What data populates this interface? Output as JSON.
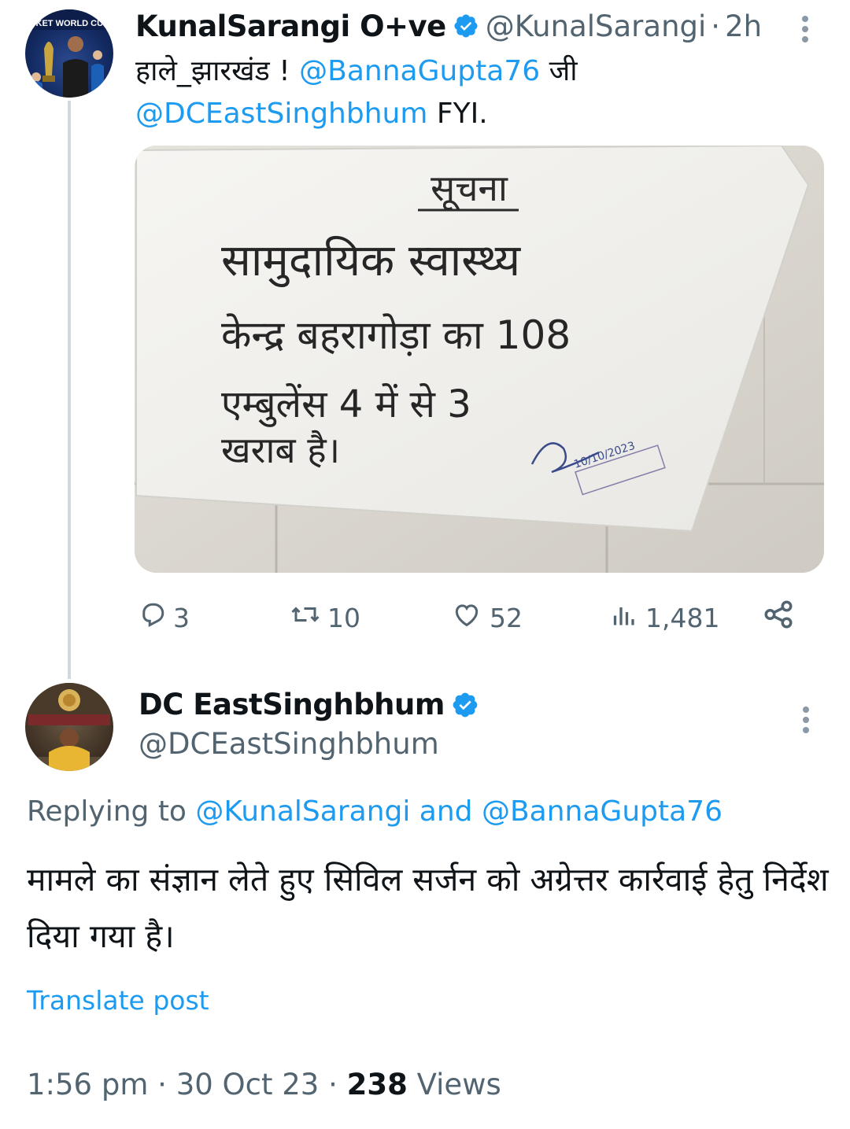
{
  "tweet": {
    "author_name": "KunalSarangi O+ve",
    "handle": "@KunalSarangi",
    "separator": "·",
    "time": "2h",
    "text_prefix": "हाले_झारखंड ! ",
    "mention_1": "@BannaGupta76",
    "text_mid": " जी",
    "mention_2": "@DCEastSinghbhum",
    "text_suffix": " FYI.",
    "avatar_text": "CKET WORLD CUP",
    "notice": {
      "heading": "सूचना",
      "line1": "सामुदायिक स्वास्थ्य",
      "line2": "केन्द्र बहरागोड़ा का 108",
      "line3": "एम्बुलेंस 4 में से 3",
      "line4": "खराब है।",
      "signature_date": "10/10/2023"
    },
    "stats": {
      "replies": "3",
      "reposts": "10",
      "likes": "52",
      "views": "1,481"
    }
  },
  "reply": {
    "author_name": "DC EastSinghbhum",
    "handle": "@DCEastSinghbhum",
    "replying_prefix": "Replying to ",
    "replying_to_1": "@KunalSarangi",
    "replying_and": " and ",
    "replying_to_2": "@BannaGupta76",
    "text": "मामले का संज्ञान लेते हुए सिविल सर्जन को अग्रेत्तर कार्रवाई हेतु निर्देश दिया गया है।",
    "translate_label": "Translate post",
    "time": "1:56 pm",
    "date": "30 Oct 23",
    "views_count": "238",
    "views_label": "Views",
    "separator": " · "
  },
  "colors": {
    "link": "#1d9bf0",
    "muted": "#536471",
    "text": "#0f1419",
    "verified": "#1d9bf0"
  },
  "icons": [
    "verified-icon",
    "more-icon",
    "reply-icon",
    "repost-icon",
    "like-icon",
    "views-icon",
    "share-icon"
  ]
}
